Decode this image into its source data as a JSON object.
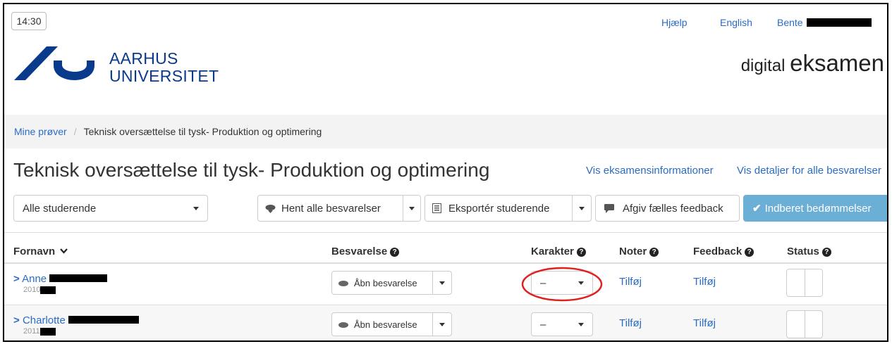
{
  "header": {
    "time": "14:30",
    "help": "Hjælp",
    "language": "English",
    "user": "Bente",
    "logo_line1": "AARHUS",
    "logo_line2": "UNIVERSITET",
    "brand_small": "digital",
    "brand_big": "eksamen"
  },
  "breadcrumb": {
    "root": "Mine prøver",
    "separator": "/",
    "current": "Teknisk oversættelse til tysk- Produktion og optimering"
  },
  "page": {
    "title": "Teknisk oversættelse til tysk- Produktion og optimering",
    "link_info": "Vis eksamensinformationer",
    "link_details": "Vis detaljer for alle besvarelser"
  },
  "toolbar": {
    "filter_value": "Alle studerende",
    "fetch_label": "Hent alle besvarelser",
    "export_label": "Eksportér studerende",
    "feedback_label": "Afgiv fælles feedback",
    "submit_label": "Indberet bedømmelser"
  },
  "table": {
    "columns": [
      "Fornavn",
      "Besvarelse",
      "Karakter",
      "Noter",
      "Feedback",
      "Status"
    ],
    "rows": [
      {
        "name": "Anne",
        "year": "2010",
        "submission": "Åbn besvarelse",
        "grade": "–",
        "notes": "Tilføj",
        "feedback": "Tilføj"
      },
      {
        "name": "Charlotte",
        "year": "2011",
        "submission": "Åbn besvarelse",
        "grade": "–",
        "notes": "Tilføj",
        "feedback": "Tilføj"
      }
    ]
  },
  "colors": {
    "link": "#2a6cc4",
    "primary": "#6baed6",
    "logo": "#0a3a8c",
    "highlight": "#e0201e"
  }
}
